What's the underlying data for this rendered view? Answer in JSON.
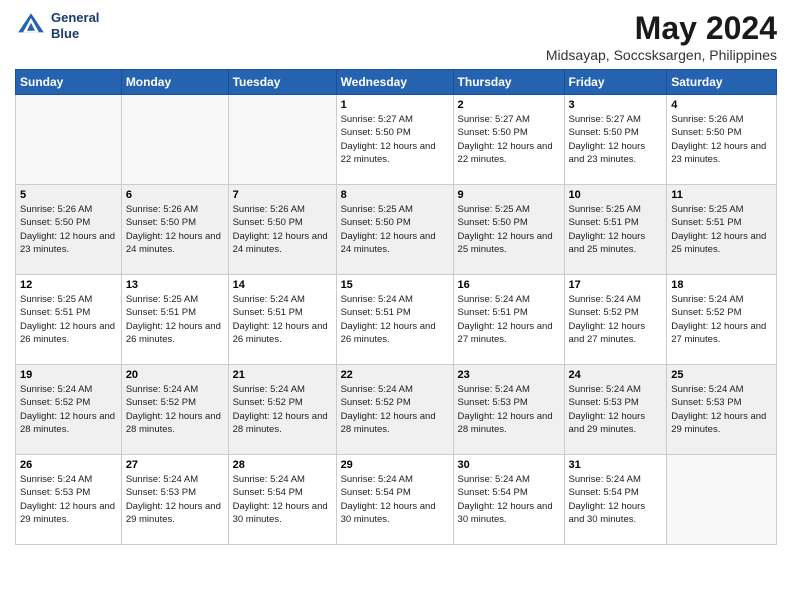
{
  "logo": {
    "line1": "General",
    "line2": "Blue"
  },
  "title": {
    "month_year": "May 2024",
    "location": "Midsayap, Soccsksargen, Philippines"
  },
  "days_of_week": [
    "Sunday",
    "Monday",
    "Tuesday",
    "Wednesday",
    "Thursday",
    "Friday",
    "Saturday"
  ],
  "weeks": [
    [
      {
        "day": "",
        "sunrise": "",
        "sunset": "",
        "daylight": ""
      },
      {
        "day": "",
        "sunrise": "",
        "sunset": "",
        "daylight": ""
      },
      {
        "day": "",
        "sunrise": "",
        "sunset": "",
        "daylight": ""
      },
      {
        "day": "1",
        "sunrise": "Sunrise: 5:27 AM",
        "sunset": "Sunset: 5:50 PM",
        "daylight": "Daylight: 12 hours and 22 minutes."
      },
      {
        "day": "2",
        "sunrise": "Sunrise: 5:27 AM",
        "sunset": "Sunset: 5:50 PM",
        "daylight": "Daylight: 12 hours and 22 minutes."
      },
      {
        "day": "3",
        "sunrise": "Sunrise: 5:27 AM",
        "sunset": "Sunset: 5:50 PM",
        "daylight": "Daylight: 12 hours and 23 minutes."
      },
      {
        "day": "4",
        "sunrise": "Sunrise: 5:26 AM",
        "sunset": "Sunset: 5:50 PM",
        "daylight": "Daylight: 12 hours and 23 minutes."
      }
    ],
    [
      {
        "day": "5",
        "sunrise": "Sunrise: 5:26 AM",
        "sunset": "Sunset: 5:50 PM",
        "daylight": "Daylight: 12 hours and 23 minutes."
      },
      {
        "day": "6",
        "sunrise": "Sunrise: 5:26 AM",
        "sunset": "Sunset: 5:50 PM",
        "daylight": "Daylight: 12 hours and 24 minutes."
      },
      {
        "day": "7",
        "sunrise": "Sunrise: 5:26 AM",
        "sunset": "Sunset: 5:50 PM",
        "daylight": "Daylight: 12 hours and 24 minutes."
      },
      {
        "day": "8",
        "sunrise": "Sunrise: 5:25 AM",
        "sunset": "Sunset: 5:50 PM",
        "daylight": "Daylight: 12 hours and 24 minutes."
      },
      {
        "day": "9",
        "sunrise": "Sunrise: 5:25 AM",
        "sunset": "Sunset: 5:50 PM",
        "daylight": "Daylight: 12 hours and 25 minutes."
      },
      {
        "day": "10",
        "sunrise": "Sunrise: 5:25 AM",
        "sunset": "Sunset: 5:51 PM",
        "daylight": "Daylight: 12 hours and 25 minutes."
      },
      {
        "day": "11",
        "sunrise": "Sunrise: 5:25 AM",
        "sunset": "Sunset: 5:51 PM",
        "daylight": "Daylight: 12 hours and 25 minutes."
      }
    ],
    [
      {
        "day": "12",
        "sunrise": "Sunrise: 5:25 AM",
        "sunset": "Sunset: 5:51 PM",
        "daylight": "Daylight: 12 hours and 26 minutes."
      },
      {
        "day": "13",
        "sunrise": "Sunrise: 5:25 AM",
        "sunset": "Sunset: 5:51 PM",
        "daylight": "Daylight: 12 hours and 26 minutes."
      },
      {
        "day": "14",
        "sunrise": "Sunrise: 5:24 AM",
        "sunset": "Sunset: 5:51 PM",
        "daylight": "Daylight: 12 hours and 26 minutes."
      },
      {
        "day": "15",
        "sunrise": "Sunrise: 5:24 AM",
        "sunset": "Sunset: 5:51 PM",
        "daylight": "Daylight: 12 hours and 26 minutes."
      },
      {
        "day": "16",
        "sunrise": "Sunrise: 5:24 AM",
        "sunset": "Sunset: 5:51 PM",
        "daylight": "Daylight: 12 hours and 27 minutes."
      },
      {
        "day": "17",
        "sunrise": "Sunrise: 5:24 AM",
        "sunset": "Sunset: 5:52 PM",
        "daylight": "Daylight: 12 hours and 27 minutes."
      },
      {
        "day": "18",
        "sunrise": "Sunrise: 5:24 AM",
        "sunset": "Sunset: 5:52 PM",
        "daylight": "Daylight: 12 hours and 27 minutes."
      }
    ],
    [
      {
        "day": "19",
        "sunrise": "Sunrise: 5:24 AM",
        "sunset": "Sunset: 5:52 PM",
        "daylight": "Daylight: 12 hours and 28 minutes."
      },
      {
        "day": "20",
        "sunrise": "Sunrise: 5:24 AM",
        "sunset": "Sunset: 5:52 PM",
        "daylight": "Daylight: 12 hours and 28 minutes."
      },
      {
        "day": "21",
        "sunrise": "Sunrise: 5:24 AM",
        "sunset": "Sunset: 5:52 PM",
        "daylight": "Daylight: 12 hours and 28 minutes."
      },
      {
        "day": "22",
        "sunrise": "Sunrise: 5:24 AM",
        "sunset": "Sunset: 5:52 PM",
        "daylight": "Daylight: 12 hours and 28 minutes."
      },
      {
        "day": "23",
        "sunrise": "Sunrise: 5:24 AM",
        "sunset": "Sunset: 5:53 PM",
        "daylight": "Daylight: 12 hours and 28 minutes."
      },
      {
        "day": "24",
        "sunrise": "Sunrise: 5:24 AM",
        "sunset": "Sunset: 5:53 PM",
        "daylight": "Daylight: 12 hours and 29 minutes."
      },
      {
        "day": "25",
        "sunrise": "Sunrise: 5:24 AM",
        "sunset": "Sunset: 5:53 PM",
        "daylight": "Daylight: 12 hours and 29 minutes."
      }
    ],
    [
      {
        "day": "26",
        "sunrise": "Sunrise: 5:24 AM",
        "sunset": "Sunset: 5:53 PM",
        "daylight": "Daylight: 12 hours and 29 minutes."
      },
      {
        "day": "27",
        "sunrise": "Sunrise: 5:24 AM",
        "sunset": "Sunset: 5:53 PM",
        "daylight": "Daylight: 12 hours and 29 minutes."
      },
      {
        "day": "28",
        "sunrise": "Sunrise: 5:24 AM",
        "sunset": "Sunset: 5:54 PM",
        "daylight": "Daylight: 12 hours and 30 minutes."
      },
      {
        "day": "29",
        "sunrise": "Sunrise: 5:24 AM",
        "sunset": "Sunset: 5:54 PM",
        "daylight": "Daylight: 12 hours and 30 minutes."
      },
      {
        "day": "30",
        "sunrise": "Sunrise: 5:24 AM",
        "sunset": "Sunset: 5:54 PM",
        "daylight": "Daylight: 12 hours and 30 minutes."
      },
      {
        "day": "31",
        "sunrise": "Sunrise: 5:24 AM",
        "sunset": "Sunset: 5:54 PM",
        "daylight": "Daylight: 12 hours and 30 minutes."
      },
      {
        "day": "",
        "sunrise": "",
        "sunset": "",
        "daylight": ""
      }
    ]
  ]
}
